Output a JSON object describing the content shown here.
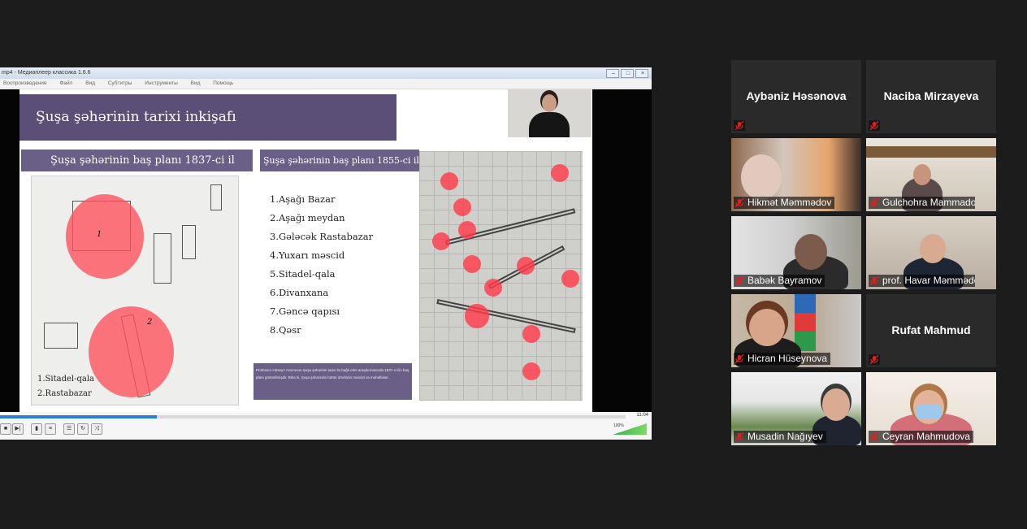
{
  "shared_screen": {
    "window_title": "mp4 - Медиаплеер классика 1.6.6",
    "menu": [
      "Воспроизведение",
      "Файл",
      "Вид",
      "Субтитры",
      "Инструменты",
      "Вид",
      "Помощь"
    ],
    "slide": {
      "title": "Şuşa şəhərinin tarixi inkişafı",
      "plan_1837_heading": "Şuşa şəhərinin baş planı 1837-ci il",
      "plan_1855_heading": "Şuşa şəhərinin baş planı 1855-ci il",
      "map1_labels": [
        "1.Sitadel-qala",
        "2.Rastabazar"
      ],
      "map1_pins": [
        "1",
        "2"
      ],
      "list": [
        "1.Aşağı Bazar",
        "2.Aşağı meydan",
        "3.Gələcək Rastabazar",
        "4.Yuxarı məscid",
        "5.Sitadel-qala",
        "6.Divanxana",
        "7.Gəncə qapısı",
        "8.Qəsr"
      ],
      "caption": "Professor Hüseyn Avəzovun Şuşa şəhərinin tarixi ilə bağlı elmi araşdırmasında 1837-ci ilin baş planı göstərilmişdir. Belə ki, Şuşa şəhərində bütün dövrlərin məscid və məhəllələri."
    },
    "player": {
      "time": "11:04",
      "volume": "100%",
      "progress_percent": 25
    }
  },
  "participants": [
    {
      "name": "Aybəniz  Həsənova",
      "video": false
    },
    {
      "name": "Naciba Mirzayeva",
      "video": false
    },
    {
      "name": "Hikmət Məmmədov",
      "video": true
    },
    {
      "name": "Gulchohra Mammadova",
      "video": true
    },
    {
      "name": "Babək Bayramov",
      "video": true
    },
    {
      "name": "prof. Havar Məmmədov",
      "video": true
    },
    {
      "name": "Hicran Hüseynova",
      "video": true
    },
    {
      "name": "Rufat Mahmud",
      "video": false
    },
    {
      "name": "Musadin Nağıyev",
      "video": true
    },
    {
      "name": "Ceyran Mahmudova",
      "video": true
    }
  ],
  "colors": {
    "slide_purple": "#5b4e77",
    "highlight_red": "#ff505a",
    "mute_red": "#e02020"
  }
}
